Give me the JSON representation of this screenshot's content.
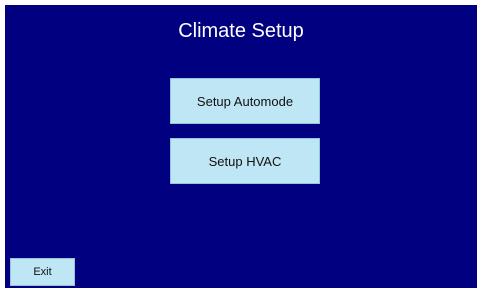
{
  "screen": {
    "title": "Climate Setup",
    "background_color": "#000080",
    "button_color": "#bfe6f5"
  },
  "buttons": {
    "setup_automode": "Setup Automode",
    "setup_hvac": "Setup HVAC",
    "exit": "Exit"
  }
}
